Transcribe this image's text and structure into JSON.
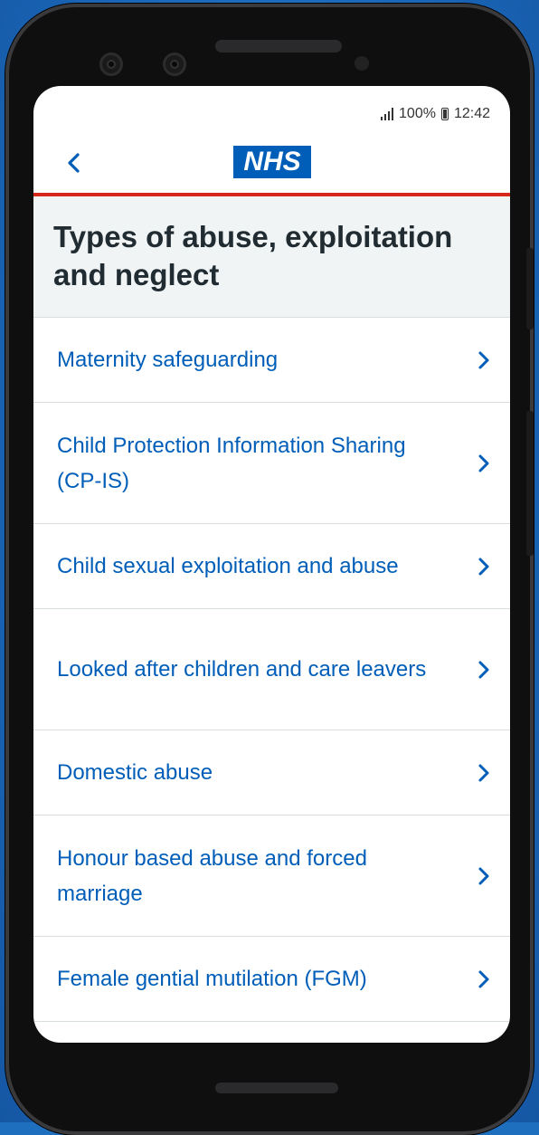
{
  "status_bar": {
    "battery": "100%",
    "time": "12:42"
  },
  "header": {
    "logo_text": "NHS",
    "back_icon": "chevron-left-icon",
    "brand_color": "#005eb8",
    "accent_color": "#d5281b"
  },
  "page": {
    "title": "Types of abuse, exploitation and neglect"
  },
  "items": [
    {
      "label": "Maternity safeguarding"
    },
    {
      "label": "Child Protection Information Sharing (CP-IS)"
    },
    {
      "label": "Child sexual exploitation and abuse"
    },
    {
      "label": "Looked after children and care leavers"
    },
    {
      "label": "Domestic abuse"
    },
    {
      "label": "Honour based abuse and forced marriage"
    },
    {
      "label": "Female gential mutilation (FGM)"
    }
  ]
}
